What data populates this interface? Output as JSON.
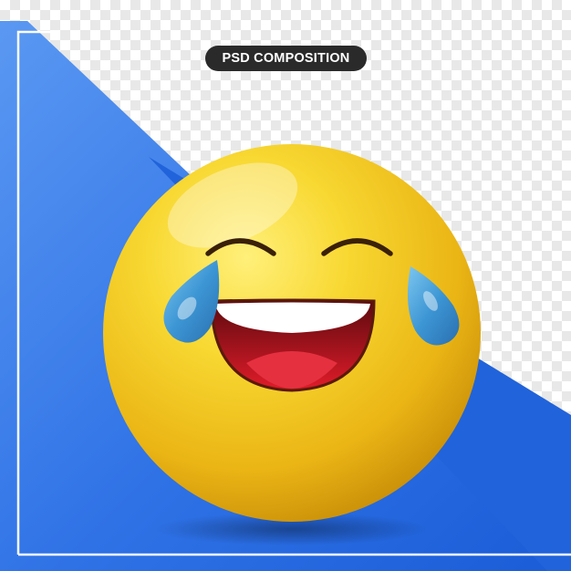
{
  "badge": {
    "label": "PSD COMPOSITION"
  },
  "emoji": {
    "name": "face-with-tears-of-joy",
    "face_color": "#f2c51c",
    "tear_color": "#4a9fd6",
    "mouth_color": "#c8101e",
    "teeth_color": "#ffffff"
  },
  "colors": {
    "panel_blue_light": "#4e8ef0",
    "panel_blue_dark": "#1b5fd9",
    "frame_line": "#ffffff",
    "checker": "#e8e8e8"
  }
}
